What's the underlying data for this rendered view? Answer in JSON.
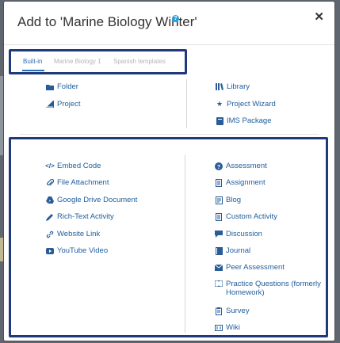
{
  "dialog": {
    "title": "Add to 'Marine Biology Winter'",
    "help_glyph": "?",
    "close_glyph": "✕"
  },
  "tabs": [
    {
      "label": "Built-in",
      "active": true
    },
    {
      "label": "Marine Biology 1",
      "active": false
    },
    {
      "label": "Spanish templates",
      "active": false
    }
  ],
  "top_left": [
    {
      "label": "Folder",
      "icon": "folder-icon"
    },
    {
      "label": "Project",
      "icon": "project-icon"
    }
  ],
  "top_right": [
    {
      "label": "Library",
      "icon": "library-icon"
    },
    {
      "label": "Project Wizard",
      "icon": "star-icon"
    },
    {
      "label": "IMS Package",
      "icon": "package-icon"
    }
  ],
  "bottom_left": [
    {
      "label": "Embed Code",
      "icon": "code-icon"
    },
    {
      "label": "File Attachment",
      "icon": "paperclip-icon"
    },
    {
      "label": "Google Drive Document",
      "icon": "google-drive-icon"
    },
    {
      "label": "Rich-Text Activity",
      "icon": "pencil-icon"
    },
    {
      "label": "Website Link",
      "icon": "link-icon"
    },
    {
      "label": "YouTube Video",
      "icon": "youtube-icon"
    }
  ],
  "bottom_right": [
    {
      "label": "Assessment",
      "icon": "question-circle-icon"
    },
    {
      "label": "Assignment",
      "icon": "document-icon"
    },
    {
      "label": "Blog",
      "icon": "blog-icon"
    },
    {
      "label": "Custom Activity",
      "icon": "document-icon"
    },
    {
      "label": "Discussion",
      "icon": "comment-icon"
    },
    {
      "label": "Journal",
      "icon": "book-icon"
    },
    {
      "label": "Peer Assessment",
      "icon": "envelope-icon"
    },
    {
      "label": "Practice Questions (formerly",
      "label2": "Homework)",
      "icon": "practice-icon"
    },
    {
      "label": "Survey",
      "icon": "clipboard-icon"
    },
    {
      "label": "Wiki",
      "icon": "wiki-icon"
    }
  ],
  "colors": {
    "link": "#1f5d9c",
    "highlight_border": "#1f3a7a",
    "tab_active": "#2a6fb5"
  }
}
